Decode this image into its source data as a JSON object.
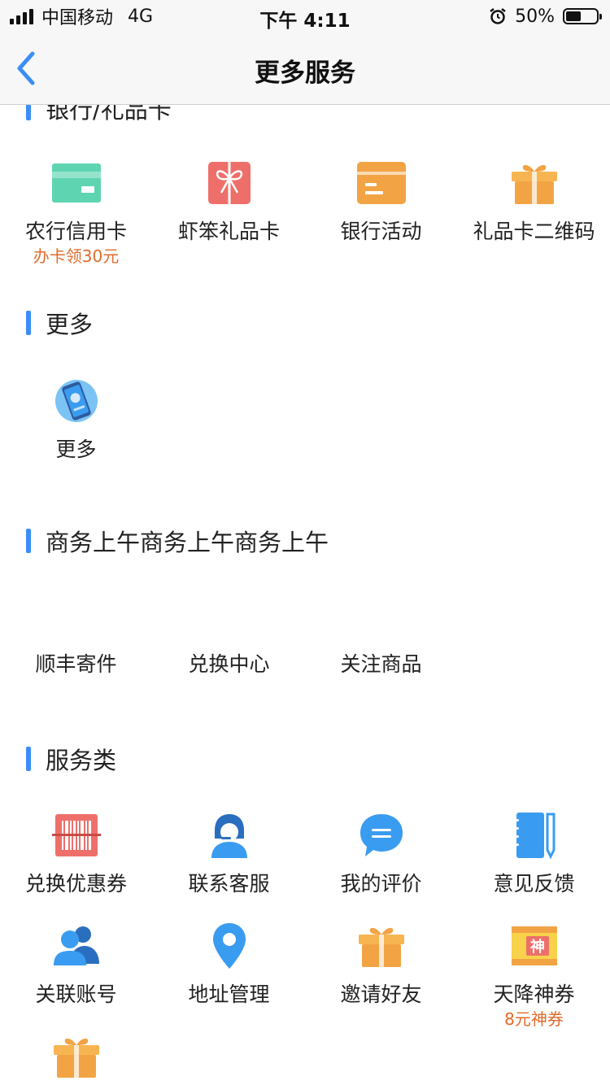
{
  "status": {
    "carrier": "中国移动",
    "network": "4G",
    "time": "下午 4:11",
    "battery": "50%"
  },
  "nav": {
    "title": "更多服务"
  },
  "sections": {
    "bank": {
      "title": "银行/礼品卡",
      "items": [
        {
          "label": "农行信用卡",
          "sub": "办卡领30元",
          "icon": "credit-card-icon"
        },
        {
          "label": "虾笨礼品卡",
          "icon": "gift-card-icon"
        },
        {
          "label": "银行活动",
          "icon": "bank-card-icon"
        },
        {
          "label": "礼品卡二维码",
          "icon": "gift-box-icon"
        }
      ]
    },
    "more": {
      "title": "更多",
      "items": [
        {
          "label": "更多",
          "icon": "phone-app-icon"
        }
      ]
    },
    "business": {
      "title": "商务上午商务上午商务上午",
      "items": [
        {
          "label": "顺丰寄件"
        },
        {
          "label": "兑换中心"
        },
        {
          "label": "关注商品"
        }
      ]
    },
    "service": {
      "title": "服务类",
      "items": [
        {
          "label": "兑换优惠券",
          "icon": "barcode-icon"
        },
        {
          "label": "联系客服",
          "icon": "customer-service-icon"
        },
        {
          "label": "我的评价",
          "icon": "comment-icon"
        },
        {
          "label": "意见反馈",
          "icon": "notebook-icon"
        },
        {
          "label": "关联账号",
          "icon": "users-icon"
        },
        {
          "label": "地址管理",
          "icon": "location-pin-icon"
        },
        {
          "label": "邀请好友",
          "icon": "gift-box-icon"
        },
        {
          "label": "天降神券",
          "sub": "8元神券",
          "icon": "coupon-icon"
        },
        {
          "label": "",
          "icon": "gift-box-icon"
        }
      ]
    }
  },
  "colors": {
    "accent": "#3a8ef6",
    "promo": "#e06b2a",
    "green": "#5fd4b1",
    "orange": "#f2a445",
    "red": "#ee6f6a",
    "blue": "#3a9cf0"
  }
}
